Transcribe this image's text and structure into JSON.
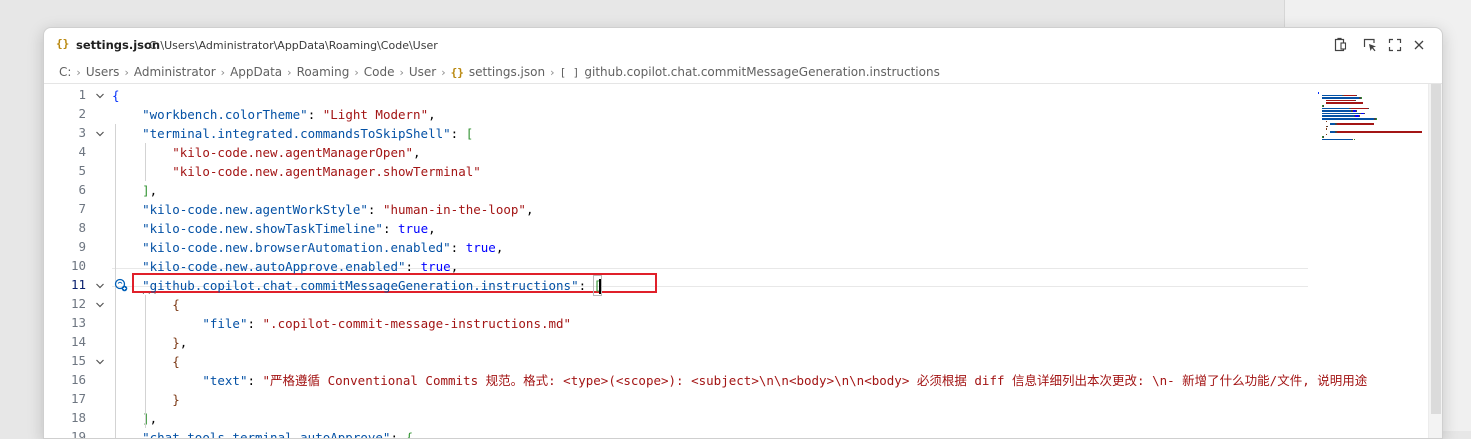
{
  "window": {
    "title_icon": "{}",
    "file_name": "settings.json",
    "file_path": "C:\\Users\\Administrator\\AppData\\Roaming\\Code\\User"
  },
  "breadcrumb": {
    "items": [
      "C:",
      "Users",
      "Administrator",
      "AppData",
      "Roaming",
      "Code",
      "User"
    ],
    "file_icon": "{}",
    "file": "settings.json",
    "symbol_icon": "[ ]",
    "symbol": "github.copilot.chat.commitMessageGeneration.instructions"
  },
  "editor": {
    "active_line": 11,
    "line_numbers": [
      "1",
      "2",
      "3",
      "4",
      "5",
      "6",
      "7",
      "8",
      "9",
      "10",
      "11",
      "12",
      "13",
      "14",
      "15",
      "16",
      "17",
      "18",
      "19"
    ],
    "folds": {
      "1": true,
      "3": true,
      "11": true,
      "12": true,
      "15": true
    },
    "lines": [
      {
        "indent": 0,
        "tokens": [
          {
            "c": "br1",
            "t": "{"
          }
        ]
      },
      {
        "indent": 1,
        "tokens": [
          {
            "c": "k",
            "t": "\"workbench.colorTheme\""
          },
          {
            "c": "p",
            "t": ": "
          },
          {
            "c": "s",
            "t": "\"Light Modern\""
          },
          {
            "c": "p",
            "t": ","
          }
        ]
      },
      {
        "indent": 1,
        "tokens": [
          {
            "c": "k",
            "t": "\"terminal.integrated.commandsToSkipShell\""
          },
          {
            "c": "p",
            "t": ": "
          },
          {
            "c": "br2",
            "t": "["
          }
        ]
      },
      {
        "indent": 2,
        "tokens": [
          {
            "c": "s",
            "t": "\"kilo-code.new.agentManagerOpen\""
          },
          {
            "c": "p",
            "t": ","
          }
        ]
      },
      {
        "indent": 2,
        "tokens": [
          {
            "c": "s",
            "t": "\"kilo-code.new.agentManager.showTerminal\""
          }
        ]
      },
      {
        "indent": 1,
        "tokens": [
          {
            "c": "br2",
            "t": "]"
          },
          {
            "c": "p",
            "t": ","
          }
        ]
      },
      {
        "indent": 1,
        "tokens": [
          {
            "c": "k",
            "t": "\"kilo-code.new.agentWorkStyle\""
          },
          {
            "c": "p",
            "t": ": "
          },
          {
            "c": "s",
            "t": "\"human-in-the-loop\""
          },
          {
            "c": "p",
            "t": ","
          }
        ]
      },
      {
        "indent": 1,
        "tokens": [
          {
            "c": "k",
            "t": "\"kilo-code.new.showTaskTimeline\""
          },
          {
            "c": "p",
            "t": ": "
          },
          {
            "c": "b",
            "t": "true"
          },
          {
            "c": "p",
            "t": ","
          }
        ]
      },
      {
        "indent": 1,
        "tokens": [
          {
            "c": "k",
            "t": "\"kilo-code.new.browserAutomation.enabled\""
          },
          {
            "c": "p",
            "t": ": "
          },
          {
            "c": "b",
            "t": "true"
          },
          {
            "c": "p",
            "t": ","
          }
        ]
      },
      {
        "indent": 1,
        "tokens": [
          {
            "c": "k",
            "t": "\"kilo-code.new.autoApprove.enabled\""
          },
          {
            "c": "p",
            "t": ": "
          },
          {
            "c": "b",
            "t": "true"
          },
          {
            "c": "p",
            "t": ","
          }
        ]
      },
      {
        "indent": 1,
        "tokens": [
          {
            "c": "k",
            "t": "\"github.copilot.chat.commitMessageGeneration.instructions\""
          },
          {
            "c": "p",
            "t": ": "
          },
          {
            "c": "br2 cursor",
            "t": "["
          }
        ]
      },
      {
        "indent": 2,
        "tokens": [
          {
            "c": "br3",
            "t": "{"
          }
        ]
      },
      {
        "indent": 3,
        "tokens": [
          {
            "c": "k",
            "t": "\"file\""
          },
          {
            "c": "p",
            "t": ": "
          },
          {
            "c": "s",
            "t": "\".copilot-commit-message-instructions.md\""
          }
        ]
      },
      {
        "indent": 2,
        "tokens": [
          {
            "c": "br3",
            "t": "}"
          },
          {
            "c": "p",
            "t": ","
          }
        ]
      },
      {
        "indent": 2,
        "tokens": [
          {
            "c": "br3",
            "t": "{"
          }
        ]
      },
      {
        "indent": 3,
        "tokens": [
          {
            "c": "k",
            "t": "\"text\""
          },
          {
            "c": "p",
            "t": ": "
          },
          {
            "c": "s",
            "t": "\"严格遵循 Conventional Commits 规范。格式: <type>(<scope>): <subject>\\n\\n<body>\\n\\n<body> 必须根据 diff 信息详细列出本次更改: \\n- 新增了什么功能/文件, 说明用途"
          }
        ]
      },
      {
        "indent": 2,
        "tokens": [
          {
            "c": "br3",
            "t": "}"
          }
        ]
      },
      {
        "indent": 1,
        "tokens": [
          {
            "c": "br2",
            "t": "]"
          },
          {
            "c": "p",
            "t": ","
          }
        ]
      },
      {
        "indent": 1,
        "tokens": [
          {
            "c": "k",
            "t": "\"chat.tools.terminal.autoApprove\""
          },
          {
            "c": "p",
            "t": ": "
          },
          {
            "c": "br2",
            "t": "{"
          }
        ]
      }
    ]
  },
  "icons": {
    "copy": "copy-icon",
    "inspect": "inspect-icon",
    "maximize": "maximize-icon",
    "close": "close-icon",
    "copilot": "copilot-sparkle-icon"
  }
}
